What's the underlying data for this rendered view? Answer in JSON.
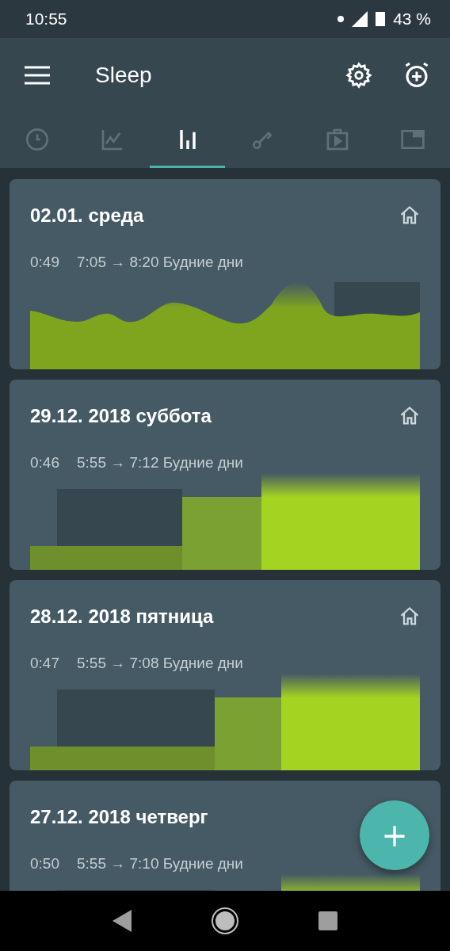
{
  "status_bar": {
    "time": "10:55",
    "battery": "43 %"
  },
  "app_bar": {
    "title": "Sleep"
  },
  "tabs": [
    {
      "kind": "clock",
      "selected": false
    },
    {
      "kind": "chart",
      "selected": false
    },
    {
      "kind": "stats",
      "selected": true
    },
    {
      "kind": "key",
      "selected": false
    },
    {
      "kind": "media",
      "selected": false
    },
    {
      "kind": "window",
      "selected": false
    }
  ],
  "records": [
    {
      "title": "02.01. среда",
      "duration": "0:49",
      "range": "7:05 → 8:20 Будние дни",
      "home": true,
      "graph": {
        "kind": "wave"
      }
    },
    {
      "title": "29.12. 2018 суббота",
      "duration": "0:46",
      "range": "5:55 → 7:12 Будние дни",
      "home": true,
      "graph": {
        "kind": "bars"
      }
    },
    {
      "title": "28.12. 2018 пятница",
      "duration": "0:47",
      "range": "5:55 → 7:08 Будние дни",
      "home": true,
      "graph": {
        "kind": "bars"
      }
    },
    {
      "title": "27.12. 2018 четверг",
      "duration": "0:50",
      "range": "5:55 → 7:10 Будние дни",
      "graph": {
        "kind": "bars"
      }
    }
  ],
  "fab": {
    "label": "+"
  }
}
